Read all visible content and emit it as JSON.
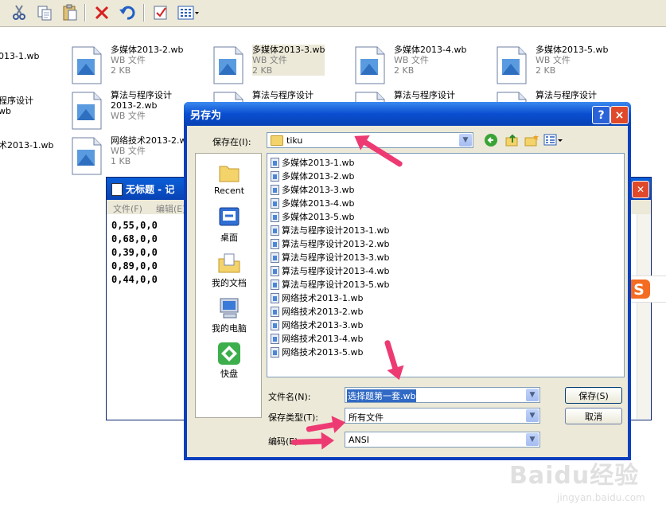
{
  "explorer": {
    "toolbar_icons": [
      "cut-icon",
      "copy-icon",
      "paste-icon",
      "delete-icon",
      "undo-icon",
      "check-icon",
      "view-icon"
    ],
    "files_row1": [
      {
        "name": "多媒体2013-2.wb",
        "type": "WB 文件",
        "size": "2 KB"
      },
      {
        "name": "多媒体2013-3.wb",
        "type": "WB 文件",
        "size": "2 KB"
      },
      {
        "name": "多媒体2013-4.wb",
        "type": "WB 文件",
        "size": "2 KB"
      },
      {
        "name": "多媒体2013-5.wb",
        "type": "WB 文件",
        "size": "2 KB"
      }
    ],
    "files_row2": [
      {
        "name": "算法与程序设计",
        "name2": "2013-2.wb",
        "type": "WB 文件"
      },
      {
        "name": "算法与程序设计"
      },
      {
        "name": "算法与程序设计"
      },
      {
        "name": "算法与程序设计"
      }
    ],
    "files_row3": [
      {
        "name": "网络技术2013-2.wb",
        "type": "WB 文件",
        "size": "1 KB"
      }
    ],
    "left_fragments": [
      "013-1.wb",
      "程序设计",
      "wb",
      "术2013-1.wb"
    ]
  },
  "notepad": {
    "title": "无标题 - 记",
    "menu": [
      "文件(F)",
      "编辑(E)"
    ],
    "lines": [
      "0,55,0,0",
      "0,68,0,0",
      "0,39,0,0",
      "0,89,0,0",
      "0,44,0,0"
    ]
  },
  "dialog": {
    "title": "另存为",
    "help_btn": "?",
    "close_btn": "×",
    "save_in_label": "保存在(I):",
    "save_in_value": "tiku",
    "places": [
      {
        "label": "Recent",
        "icon": "recent-folder-icon"
      },
      {
        "label": "桌面",
        "icon": "desktop-icon"
      },
      {
        "label": "我的文档",
        "icon": "my-documents-icon"
      },
      {
        "label": "我的电脑",
        "icon": "my-computer-icon"
      },
      {
        "label": "快盘",
        "icon": "kuaipan-icon"
      }
    ],
    "files": [
      "多媒体2013-1.wb",
      "多媒体2013-2.wb",
      "多媒体2013-3.wb",
      "多媒体2013-4.wb",
      "多媒体2013-5.wb",
      "算法与程序设计2013-1.wb",
      "算法与程序设计2013-2.wb",
      "算法与程序设计2013-3.wb",
      "算法与程序设计2013-4.wb",
      "算法与程序设计2013-5.wb",
      "网络技术2013-1.wb",
      "网络技术2013-2.wb",
      "网络技术2013-3.wb",
      "网络技术2013-4.wb",
      "网络技术2013-5.wb"
    ],
    "filename_label": "文件名(N):",
    "filename_value": "选择题第一套.wb",
    "filetype_label": "保存类型(T):",
    "filetype_value": "所有文件",
    "encoding_label": "编码(E):",
    "encoding_value": "ANSI",
    "save_btn": "保存(S)",
    "cancel_btn": "取消"
  },
  "watermark": {
    "brand": "Baidu经验",
    "url": "jingyan.baidu.com"
  },
  "colors": {
    "xp_title": "#0a4ed0",
    "dialog_bg": "#ece9d8",
    "arrow": "#ee3a72",
    "selection": "#316ac5"
  }
}
